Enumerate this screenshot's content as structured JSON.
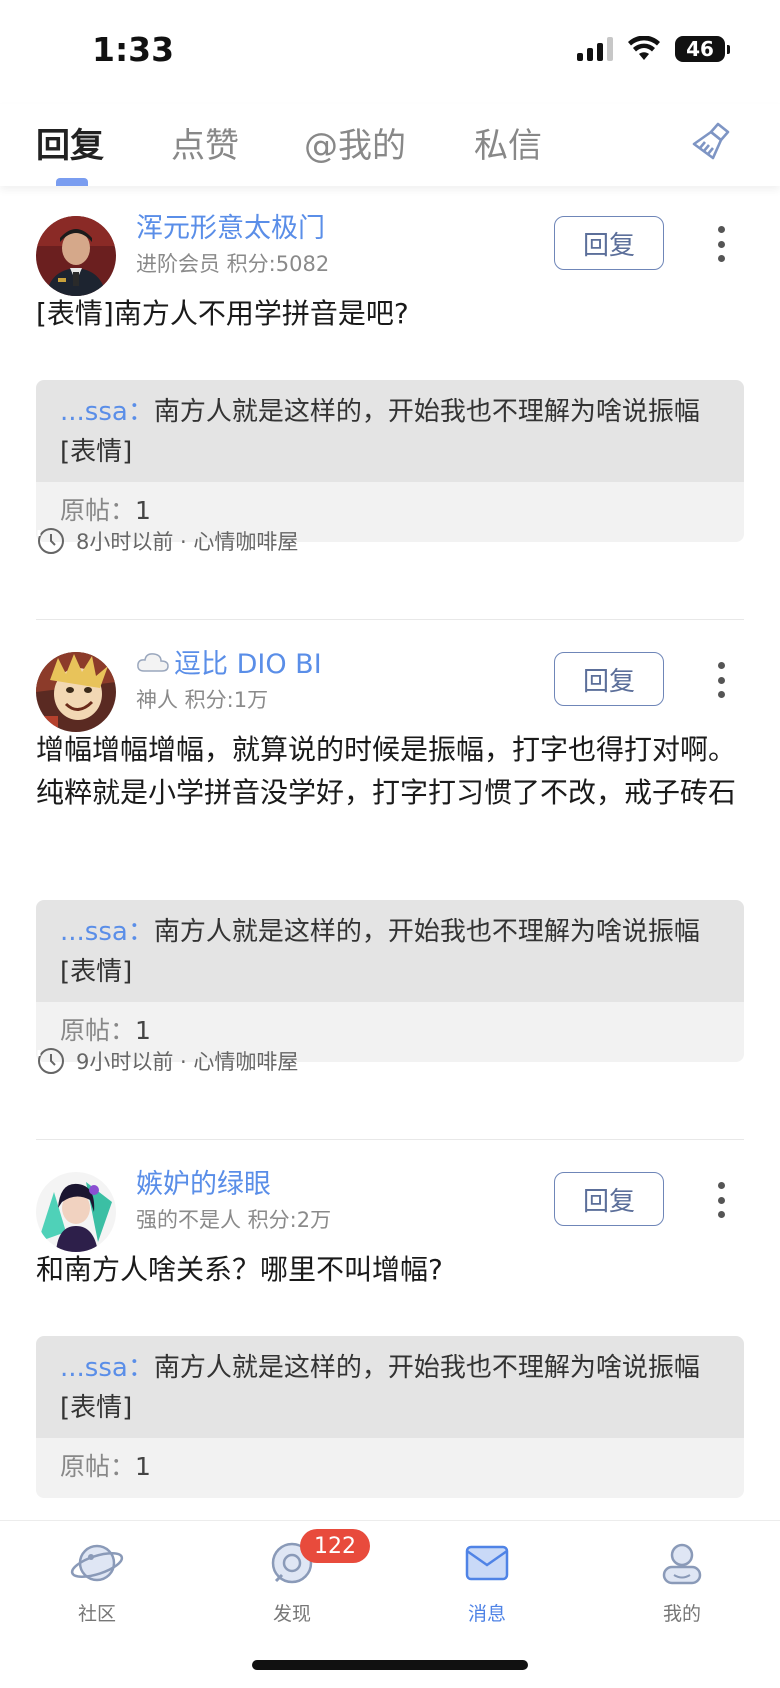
{
  "status": {
    "time": "1:33",
    "battery": "46"
  },
  "tabs": [
    {
      "label": "回复",
      "active": true
    },
    {
      "label": "点赞",
      "active": false
    },
    {
      "label": "@我的",
      "active": false
    },
    {
      "label": "私信",
      "active": false
    }
  ],
  "posts": [
    {
      "name": "浑元形意太极门",
      "meta": "进阶会员 积分:5082",
      "reply_label": "回复",
      "text": "[表情]南方人不用学拼音是吧?",
      "quote_user": "...ssa：",
      "quote_text": "南方人就是这样的，开始我也不理解为啥说振幅[表情]",
      "orig_label": "原帖：",
      "orig_value": "1",
      "time": "8小时以前 · 心情咖啡屋"
    },
    {
      "name": "逗比 DIO BI",
      "meta": "神人 积分:1万",
      "reply_label": "回复",
      "text": "增幅增幅增幅，就算说的时候是振幅，打字也得打对啊。纯粹就是小学拼音没学好，打字打习惯了不改，戒子砖石",
      "quote_user": "...ssa：",
      "quote_text": "南方人就是这样的，开始我也不理解为啥说振幅[表情]",
      "orig_label": "原帖：",
      "orig_value": "1",
      "time": "9小时以前 · 心情咖啡屋"
    },
    {
      "name": "嫉妒的绿眼",
      "meta": "强的不是人 积分:2万",
      "reply_label": "回复",
      "text": "和南方人啥关系？哪里不叫增幅?",
      "quote_user": "...ssa：",
      "quote_text": "南方人就是这样的，开始我也不理解为啥说振幅[表情]",
      "orig_label": "原帖：",
      "orig_value": "1"
    }
  ],
  "nav": {
    "community": "社区",
    "discover": "发现",
    "discover_badge": "122",
    "messages": "消息",
    "mine": "我的"
  },
  "colors": {
    "accent": "#5a8ee8",
    "badge": "#e84b3c"
  }
}
